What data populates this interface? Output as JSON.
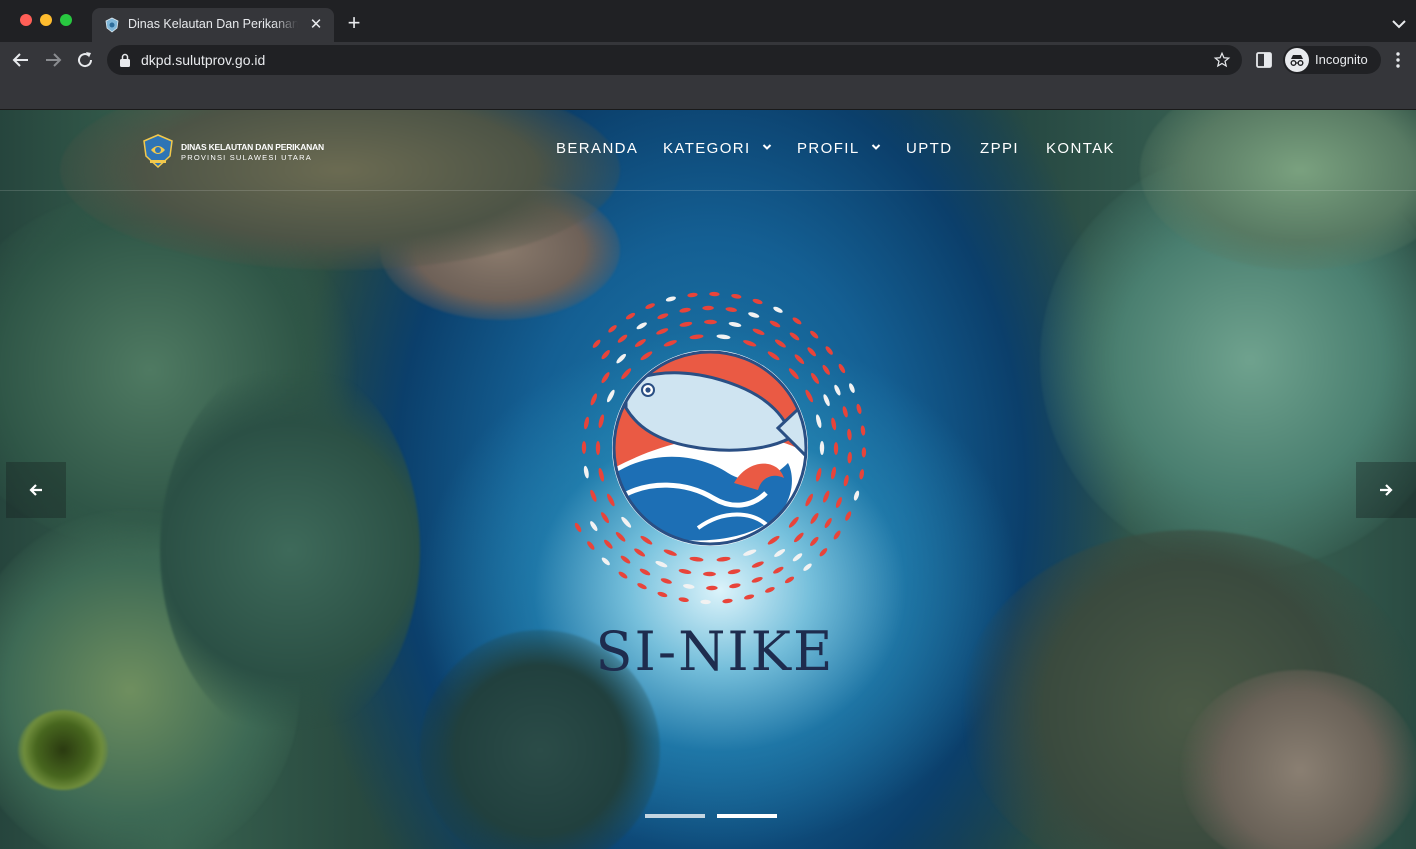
{
  "browser": {
    "tab": {
      "title": "Dinas Kelautan Dan Perikanan Provinsi Sulawesi Utara",
      "close_glyph": "✕"
    },
    "new_tab_glyph": "+",
    "url": "dkpd.sulutprov.go.id",
    "profile_label": "Incognito"
  },
  "site": {
    "brand": {
      "line1": "DINAS KELAUTAN DAN PERIKANAN",
      "line2": "PROVINSI SULAWESI UTARA"
    },
    "nav": [
      {
        "label": "BERANDA",
        "has_dropdown": false
      },
      {
        "label": "KATEGORI",
        "has_dropdown": true
      },
      {
        "label": "PROFIL",
        "has_dropdown": true
      },
      {
        "label": "UPTD",
        "has_dropdown": false
      },
      {
        "label": "ZPPI",
        "has_dropdown": false
      },
      {
        "label": "KONTAK",
        "has_dropdown": false
      }
    ],
    "hero": {
      "logo_text": "SI-NIKE",
      "slides_count": 2,
      "active_slide": 2
    }
  },
  "colors": {
    "logo_red": "#e8443a",
    "logo_blue": "#1d6fb5",
    "logo_text": "#1e2c4e",
    "chrome_bg": "#202124",
    "toolbar_bg": "#35363a"
  }
}
